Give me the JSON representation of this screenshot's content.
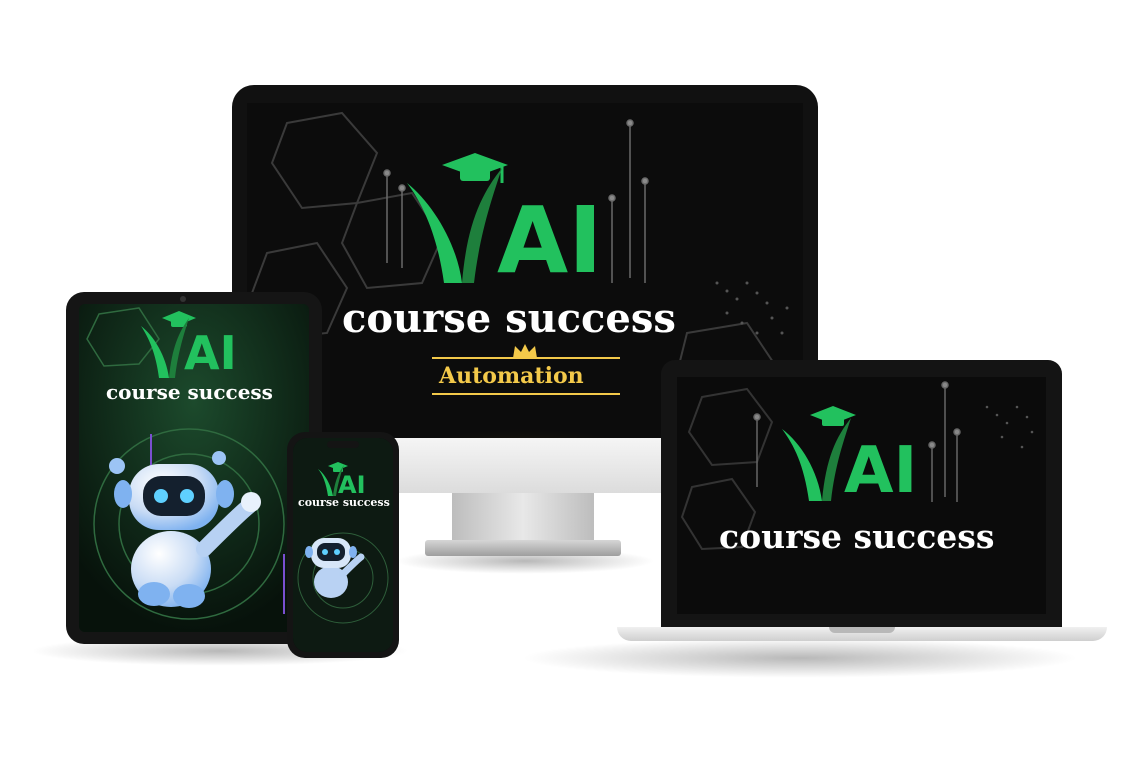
{
  "brand": {
    "logo_word": "AI",
    "title": "course success",
    "subtitle": "Automation"
  },
  "colors": {
    "brand_green": "#22c15e",
    "gold": "#f3c94a",
    "screen_bg": "#0c0c0c",
    "robot_blue": "#7fb2f0"
  },
  "icons": {
    "cap": "graduation-cap-icon",
    "crown": "crown-icon",
    "robot": "robot-mascot"
  }
}
